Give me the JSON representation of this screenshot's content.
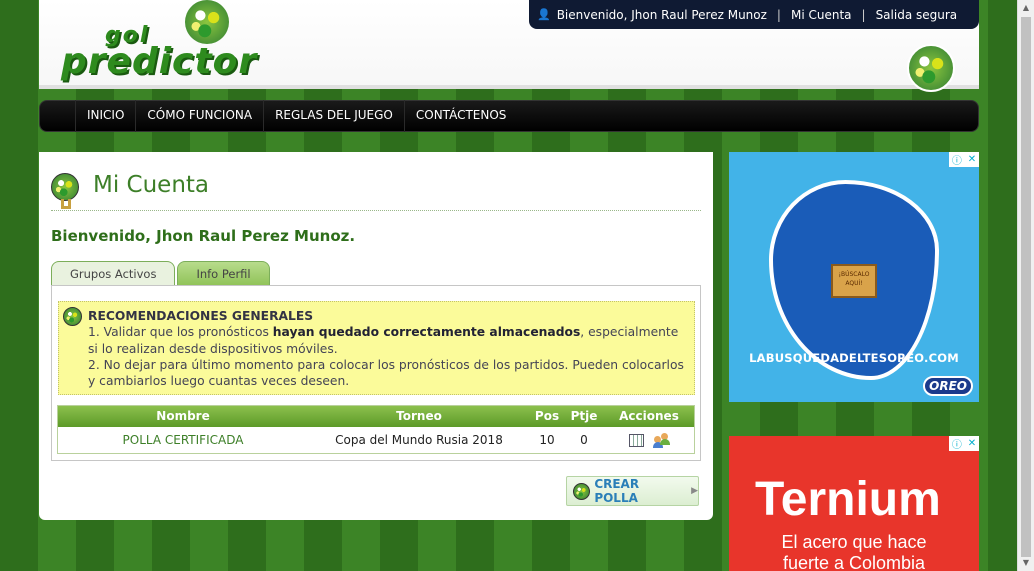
{
  "header": {
    "logo_line1": "gol",
    "logo_line2": "predictor",
    "welcome_user": "Bienvenido, Jhon Raul Perez Munoz",
    "my_account": "Mi Cuenta",
    "logout": "Salida segura"
  },
  "nav": {
    "items": [
      "INICIO",
      "CÓMO FUNCIONA",
      "REGLAS DEL JUEGO",
      "CONTÁCTENOS"
    ]
  },
  "main": {
    "title": "Mi Cuenta",
    "welcome": "Bienvenido, Jhon Raul Perez Munoz.",
    "tabs": [
      "Grupos Activos",
      "Info Perfil"
    ],
    "notice": {
      "title": "RECOMENDACIONES GENERALES",
      "line1_a": "1. Validar que los pronósticos ",
      "line1_b": "hayan quedado correctamente almacenados",
      "line1_c": ", especialmente si lo realizan desde dispositivos móviles.",
      "line2": "2. No dejar para último momento para colocar los pronósticos de los partidos. Pueden colocarlos y cambiarlos luego cuantas veces deseen."
    },
    "table": {
      "headers": [
        "Nombre",
        "Torneo",
        "Pos",
        "Ptje",
        "Acciones"
      ],
      "rows": [
        {
          "nombre": "POLLA CERTIFICADA",
          "torneo": "Copa del Mundo Rusia 2018",
          "pos": "10",
          "ptje": "0"
        }
      ]
    },
    "create_button": "CREAR POLLA"
  },
  "ads": {
    "ad1_text": "LABUSQUEDADELTESOREO.COM",
    "ad1_sign": "¡BÚSCALO AQUÍ!",
    "ad1_brand": "OREO",
    "ad2_brand": "Ternium",
    "ad2_tag_line1": "El acero que hace",
    "ad2_tag_line2": "fuerte a Colombia"
  }
}
